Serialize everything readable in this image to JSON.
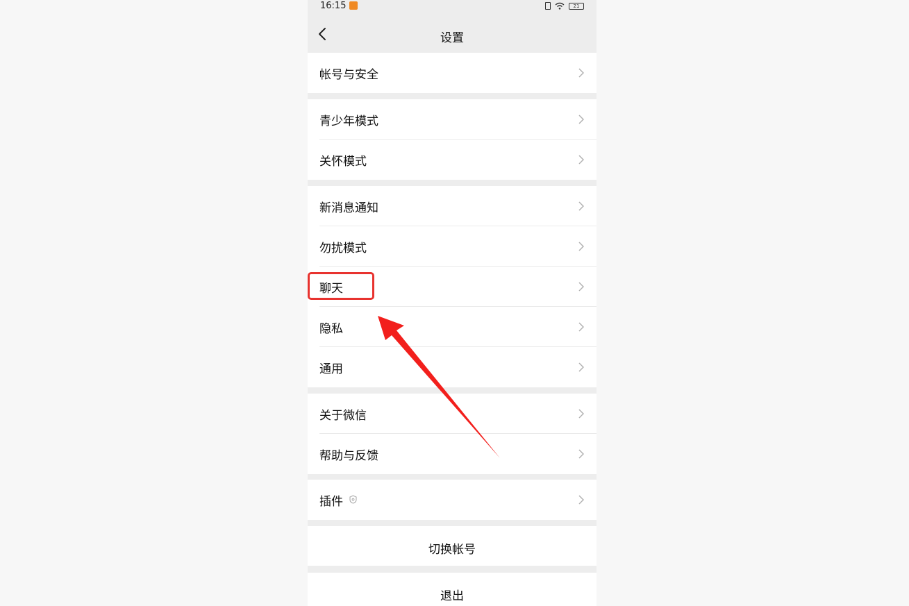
{
  "status": {
    "time": "16:15",
    "battery": "21"
  },
  "header": {
    "title": "设置"
  },
  "groups": [
    {
      "items": [
        {
          "label": "帐号与安全"
        }
      ]
    },
    {
      "items": [
        {
          "label": "青少年模式"
        },
        {
          "label": "关怀模式"
        }
      ]
    },
    {
      "items": [
        {
          "label": "新消息通知"
        },
        {
          "label": "勿扰模式"
        },
        {
          "label": "聊天"
        },
        {
          "label": "隐私"
        },
        {
          "label": "通用"
        }
      ]
    },
    {
      "items": [
        {
          "label": "关于微信"
        },
        {
          "label": "帮助与反馈"
        }
      ]
    },
    {
      "items": [
        {
          "label": "插件"
        }
      ]
    }
  ],
  "actions": {
    "switch_account": "切换帐号",
    "logout": "退出"
  },
  "annotation": {
    "highlight_color": "#e8332f"
  }
}
